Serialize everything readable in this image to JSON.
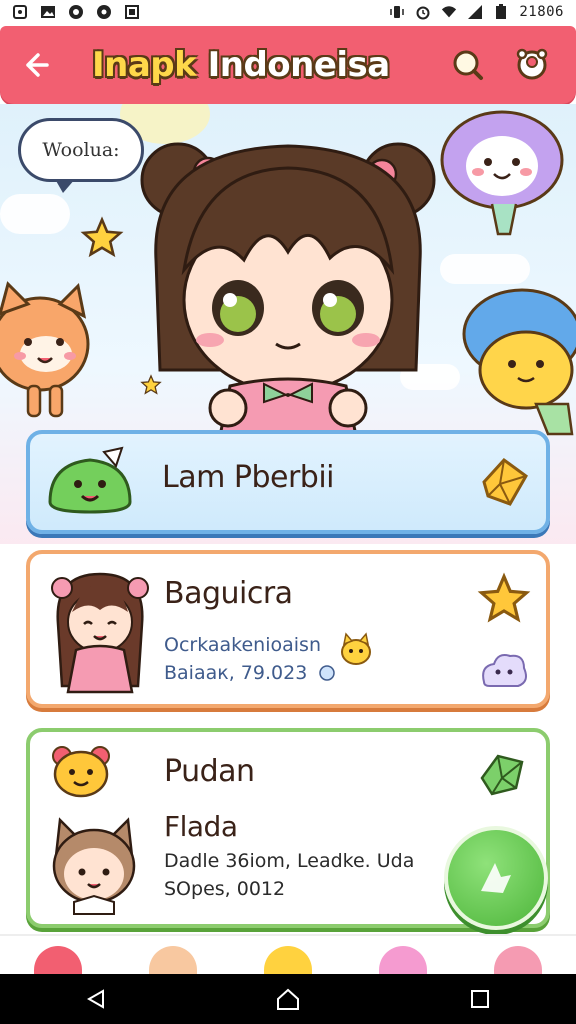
{
  "status_bar": {
    "time": "21806",
    "left_icons": [
      "notification-icon",
      "gallery-icon",
      "chrome-icon",
      "media-icon",
      "screenshot-icon"
    ],
    "right_icons": [
      "vibrate-icon",
      "alarm-icon",
      "wifi-icon",
      "signal-icon",
      "battery-icon"
    ]
  },
  "header": {
    "title_part1": "Inapk",
    "title_part2": " Indoneisa",
    "back_icon": "back-arrow-icon",
    "actions": [
      "search-icon",
      "profile-icon"
    ],
    "bg_color": "#f25f71"
  },
  "hero": {
    "speech_text": "Woolua:"
  },
  "cards": [
    {
      "title": "Lam Pberbii",
      "icon": "green-slime-icon",
      "action_icon": "gold-gem-icon"
    },
    {
      "title": "Baguicra",
      "line1": "Ocrkaakenioaisn",
      "line2": "Baiaак, 79.023",
      "avatar": "pink-girl-avatar",
      "badge_icon": "star-icon",
      "extra_icon": "cloud-pet-icon"
    },
    {
      "title": "Pudan",
      "subtitle": "Flada",
      "line1": "Dadle 36iom, Leadke. Uda",
      "line2": "SOpes, 0012",
      "avatar_top": "yellow-bear-icon",
      "avatar_bottom": "cat-girl-avatar",
      "badge_icon": "green-crystal-icon"
    }
  ],
  "fab": {
    "icon": "add-icon"
  },
  "bottom_tabs": [
    "tab-home",
    "tab-pets",
    "tab-star",
    "tab-friends",
    "tab-profile"
  ],
  "nav_bar": {
    "buttons": [
      "back-nav",
      "home-nav",
      "recents-nav"
    ]
  }
}
